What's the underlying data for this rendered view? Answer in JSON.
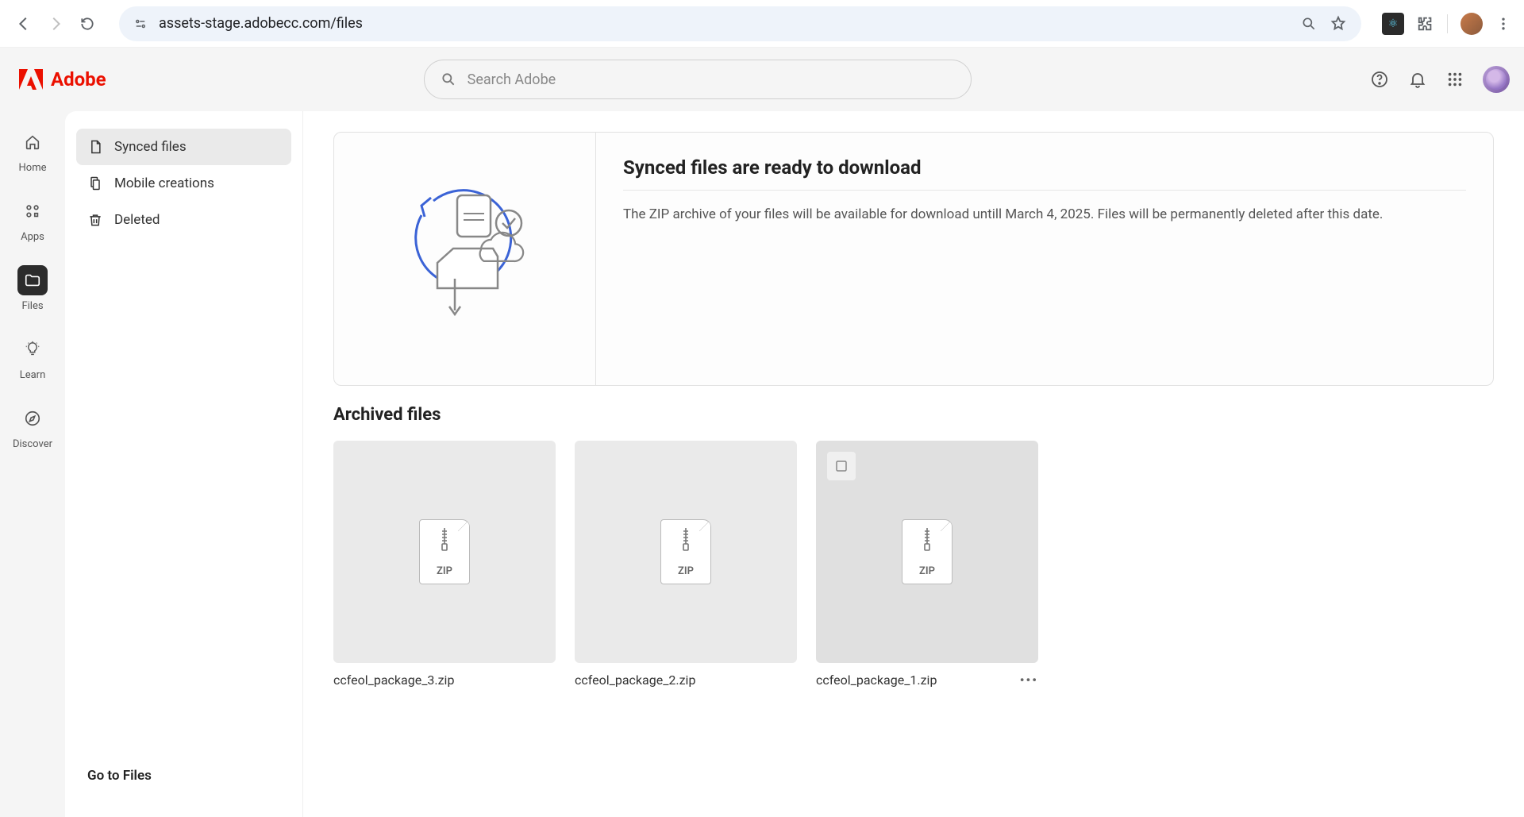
{
  "browser": {
    "url": "assets-stage.adobecc.com/files"
  },
  "brand": {
    "name": "Adobe"
  },
  "search": {
    "placeholder": "Search Adobe"
  },
  "rail": {
    "items": [
      {
        "id": "home",
        "label": "Home"
      },
      {
        "id": "apps",
        "label": "Apps"
      },
      {
        "id": "files",
        "label": "Files"
      },
      {
        "id": "learn",
        "label": "Learn"
      },
      {
        "id": "discover",
        "label": "Discover"
      }
    ],
    "active": "files"
  },
  "sidenav": {
    "items": [
      {
        "id": "synced",
        "label": "Synced files"
      },
      {
        "id": "mobile",
        "label": "Mobile creations"
      },
      {
        "id": "deleted",
        "label": "Deleted"
      }
    ],
    "active": "synced",
    "footer": "Go to Files"
  },
  "banner": {
    "title": "Synced files are ready to download",
    "description": "The ZIP archive of your files will be available for download untill March 4, 2025. Files will be permanently deleted after this date."
  },
  "section": {
    "title": "Archived files"
  },
  "files": [
    {
      "name": "ccfeol_package_3.zip",
      "type": "ZIP",
      "hovered": false
    },
    {
      "name": "ccfeol_package_2.zip",
      "type": "ZIP",
      "hovered": false
    },
    {
      "name": "ccfeol_package_1.zip",
      "type": "ZIP",
      "hovered": true
    }
  ]
}
